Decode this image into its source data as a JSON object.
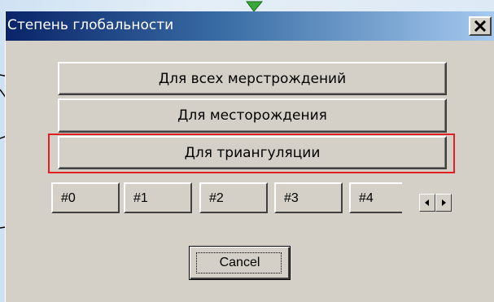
{
  "dialog": {
    "title": "Степень глобальности",
    "close_label": "X"
  },
  "buttons": {
    "all_fields": "Для всех мерстрождений",
    "field": "Для месторождения",
    "triangulation": "Для триангуляции"
  },
  "tabs": [
    "#0",
    "#1",
    "#2",
    "#3",
    "#4"
  ],
  "spin": {
    "left_icon": "triangle-left-icon",
    "right_icon": "triangle-right-icon"
  },
  "cancel": {
    "label": "Cancel"
  },
  "colors": {
    "dialog_face": "#d4d0c8",
    "title_start": "#0a246a",
    "title_end": "#a6caf0",
    "highlight": "#e02020",
    "arrow_marker": "#38a838"
  }
}
